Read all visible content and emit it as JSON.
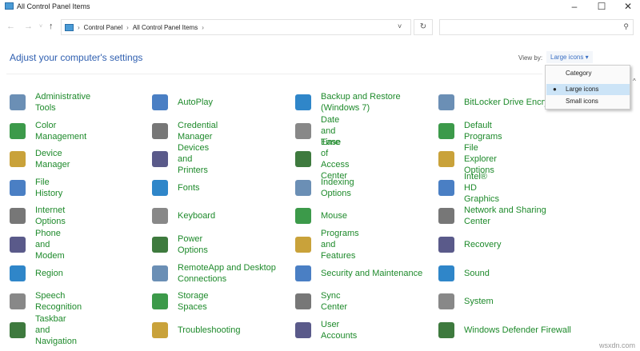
{
  "window": {
    "title": "All Control Panel Items"
  },
  "address": {
    "crumbs": [
      "Control Panel",
      "All Control Panel Items"
    ]
  },
  "search": {
    "placeholder": ""
  },
  "header": {
    "title": "Adjust your computer's settings",
    "view_by_label": "View by:",
    "view_by_value": "Large icons ▾"
  },
  "view_menu": {
    "options": [
      "Category",
      "Large icons",
      "Small icons"
    ],
    "selected": "Large icons"
  },
  "items": [
    [
      "Administrative Tools",
      "Color Management",
      "Device Manager",
      "File History",
      "Internet Options",
      "Phone and Modem",
      "Region",
      "Speech Recognition",
      "Taskbar and Navigation"
    ],
    [
      "AutoPlay",
      "Credential Manager",
      "Devices and Printers",
      "Fonts",
      "Keyboard",
      "Power Options",
      "RemoteApp and Desktop Connections",
      "Storage Spaces",
      "Troubleshooting"
    ],
    [
      "Backup and Restore (Windows 7)",
      "Date and Time",
      "Ease of Access Center",
      "Indexing Options",
      "Mouse",
      "Programs and Features",
      "Security and Maintenance",
      "Sync Center",
      "User Accounts"
    ],
    [
      "BitLocker Drive Encryption",
      "Default Programs",
      "File Explorer Options",
      "Intel® HD Graphics",
      "Network and Sharing Center",
      "Recovery",
      "Sound",
      "System",
      "Windows Defender Firewall"
    ]
  ],
  "icon_colors": [
    "#6b8fb5",
    "#3c9a4a",
    "#c9a23a",
    "#4a7fc4",
    "#777777",
    "#5a5a8a",
    "#2f86c9",
    "#888888",
    "#3e7a3e"
  ],
  "watermark": "wsxdn.com"
}
